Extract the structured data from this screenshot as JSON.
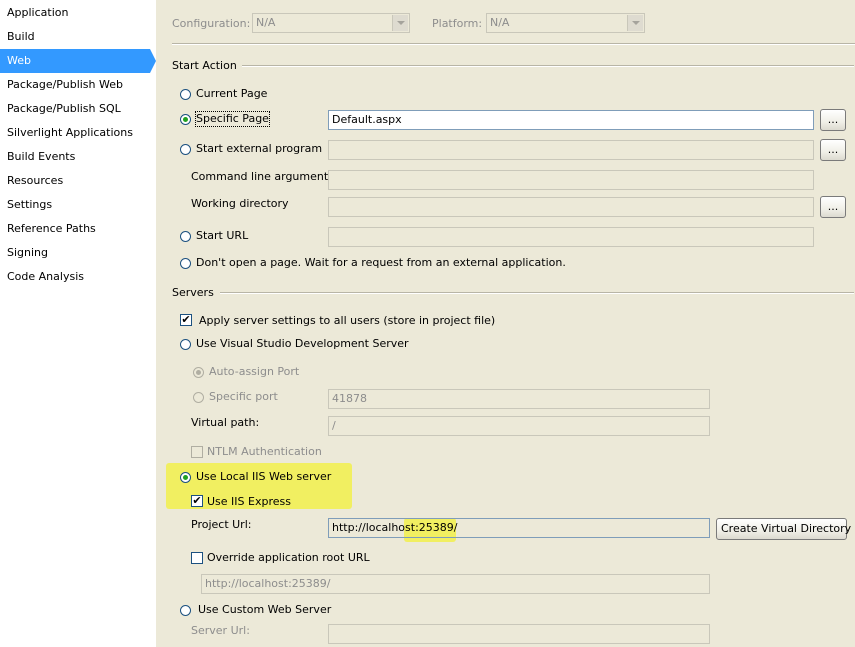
{
  "sidebar": {
    "items": [
      {
        "label": "Application"
      },
      {
        "label": "Build"
      },
      {
        "label": "Web",
        "active": true
      },
      {
        "label": "Package/Publish Web"
      },
      {
        "label": "Package/Publish SQL"
      },
      {
        "label": "Silverlight Applications"
      },
      {
        "label": "Build Events"
      },
      {
        "label": "Resources"
      },
      {
        "label": "Settings"
      },
      {
        "label": "Reference Paths"
      },
      {
        "label": "Signing"
      },
      {
        "label": "Code Analysis"
      }
    ]
  },
  "header": {
    "configuration_label": "Configuration:",
    "configuration_value": "N/A",
    "platform_label": "Platform:",
    "platform_value": "N/A"
  },
  "start_action": {
    "section_label": "Start Action",
    "current_page_label": "Current Page",
    "specific_page_label": "Specific Page",
    "specific_page_value": "Default.aspx",
    "start_external_label": "Start external program",
    "command_line_label": "Command line arguments",
    "working_dir_label": "Working directory",
    "start_url_label": "Start URL",
    "dont_open_label": "Don't open a page.  Wait for a request from an external application.",
    "browse_label": "..."
  },
  "servers": {
    "section_label": "Servers",
    "apply_all_label": "Apply server settings to all users (store in project file)",
    "vs_dev_server_label": "Use Visual Studio Development Server",
    "auto_assign_label": "Auto-assign Port",
    "specific_port_label": "Specific port",
    "specific_port_value": "41878",
    "virtual_path_label": "Virtual path:",
    "virtual_path_value": "/",
    "ntlm_label": "NTLM Authentication",
    "local_iis_label": "Use Local IIS Web server",
    "iis_express_label": "Use IIS Express",
    "project_url_label": "Project Url:",
    "project_url_value": "http://localhost:25389/",
    "create_vdir_label": "Create Virtual Directory",
    "override_root_label": "Override application root URL",
    "override_root_value": "http://localhost:25389/",
    "custom_server_label": "Use Custom Web Server",
    "server_url_label": "Server Url:",
    "server_url_value": ""
  },
  "colors": {
    "active_item": "#3399ff",
    "highlight": "#f2f04c",
    "background": "#ece9d8"
  }
}
